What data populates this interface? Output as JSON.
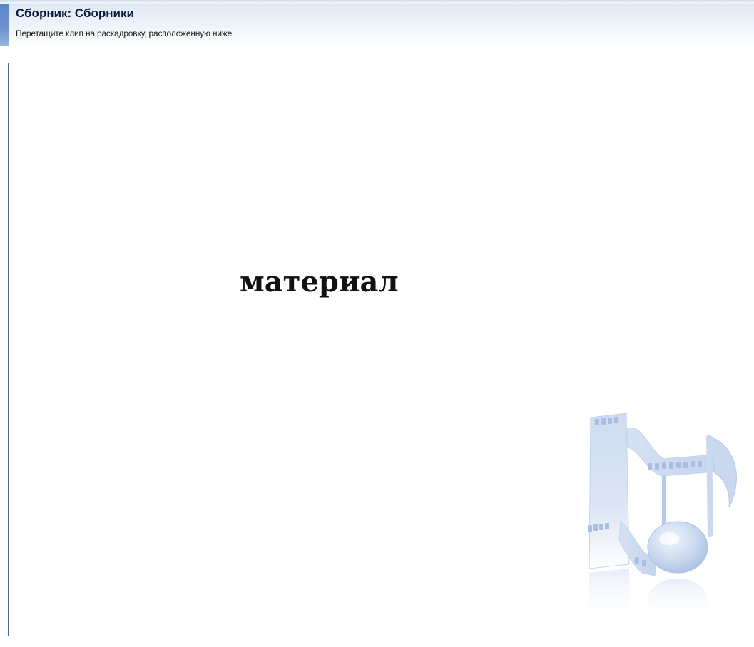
{
  "header": {
    "title": "Сборник: Сборники",
    "subtitle": "Перетащите клип на раскадровку, расположенную ниже."
  },
  "main": {
    "placeholder_word": "материал"
  },
  "watermark": {
    "icon": "film-music-note-icon"
  },
  "colors": {
    "accent": "#5b85c9",
    "header_bg": "#dfe8f5",
    "border": "#4a6d95",
    "watermark": "#c6d6ee"
  }
}
